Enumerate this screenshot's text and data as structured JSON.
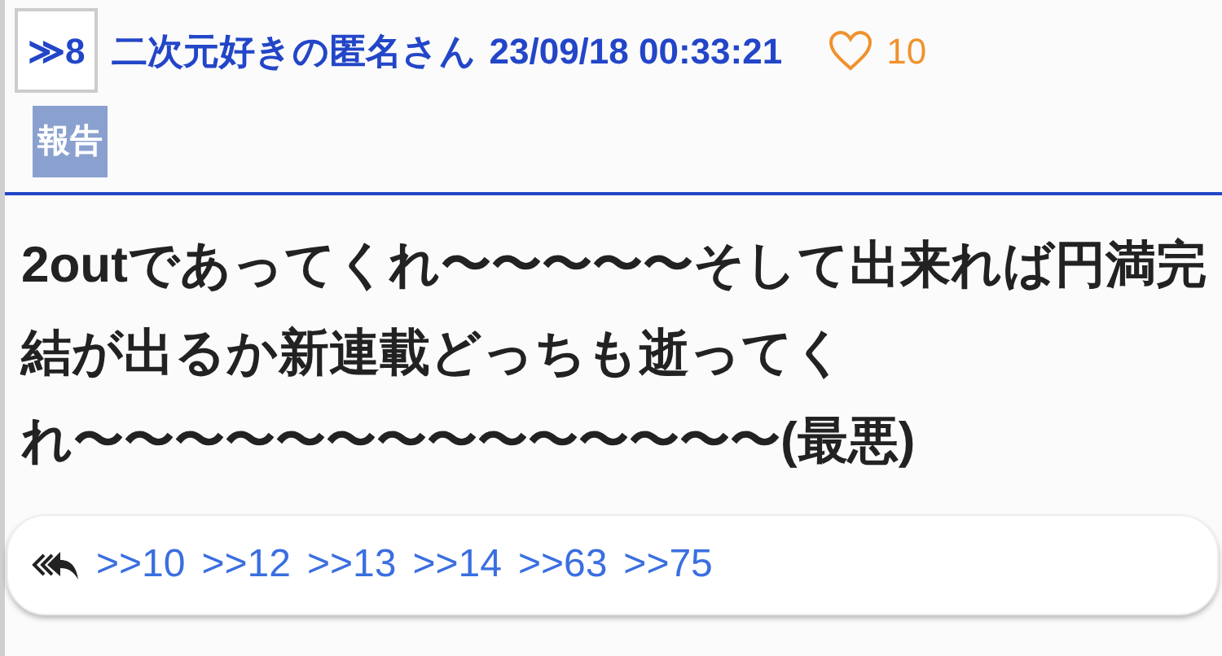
{
  "post": {
    "number": "≫8",
    "author": "二次元好きの匿名さん",
    "timestamp": "23/09/18 00:33:21",
    "likes": "10",
    "liked": false,
    "report_label": "報告",
    "body": "2outであってくれ〜〜〜〜〜そして出来れば円満完結が出るか新連載どっちも逝ってくれ〜〜〜〜〜〜〜〜〜〜〜〜〜〜(最悪)",
    "replies": [
      ">>10",
      ">>12",
      ">>13",
      ">>14",
      ">>63",
      ">>75"
    ]
  }
}
